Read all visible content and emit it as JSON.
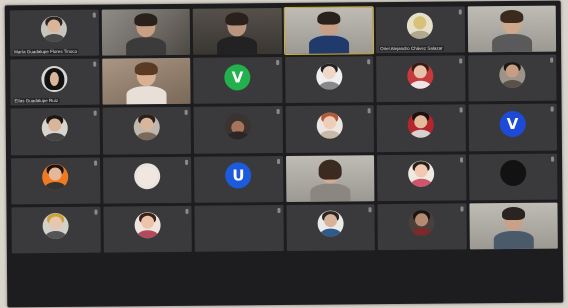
{
  "meeting": {
    "view": "gallery",
    "grid_columns": 6,
    "grid_rows": 6
  },
  "participants": [
    {
      "name": "María Guadalupe Flores Tinoco",
      "type": "avatar"
    },
    {
      "name": "",
      "type": "video"
    },
    {
      "name": "",
      "type": "video"
    },
    {
      "name": "",
      "type": "video"
    },
    {
      "name": "Oriel Alejandro Chávez Salazar",
      "type": "avatar"
    },
    {
      "name": "",
      "type": "video"
    },
    {
      "name": "Elías Guadalupe Ruiz",
      "type": "avatar"
    },
    {
      "name": "",
      "type": "video"
    },
    {
      "name": "",
      "type": "initial",
      "initial": "V",
      "color": "#22b14c"
    },
    {
      "name": "",
      "type": "avatar"
    },
    {
      "name": "",
      "type": "avatar"
    },
    {
      "name": "",
      "type": "avatar"
    },
    {
      "name": "",
      "type": "avatar"
    },
    {
      "name": "",
      "type": "avatar"
    },
    {
      "name": "",
      "type": "avatar"
    },
    {
      "name": "",
      "type": "avatar"
    },
    {
      "name": "",
      "type": "avatar"
    },
    {
      "name": "",
      "type": "initial",
      "initial": "V",
      "color": "#1e4ad8"
    },
    {
      "name": "",
      "type": "avatar"
    },
    {
      "name": "",
      "type": "avatar"
    },
    {
      "name": "",
      "type": "initial",
      "initial": "U",
      "color": "#1e5bdc"
    },
    {
      "name": "",
      "type": "video"
    },
    {
      "name": "",
      "type": "avatar"
    },
    {
      "name": "",
      "type": "avatar"
    },
    {
      "name": "",
      "type": "avatar"
    },
    {
      "name": "",
      "type": "avatar"
    },
    {
      "name": "",
      "type": "text"
    },
    {
      "name": "",
      "type": "avatar"
    },
    {
      "name": "",
      "type": "avatar"
    },
    {
      "name": "",
      "type": "video"
    }
  ]
}
